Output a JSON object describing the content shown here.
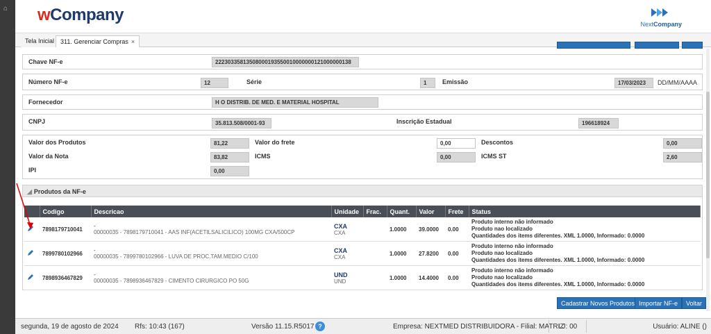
{
  "header": {
    "logo_w": "w",
    "logo_company": "Company",
    "next_logo_prefix": "Next",
    "next_logo_suffix": "Company"
  },
  "tabs": [
    {
      "label": "Tela Inicial"
    },
    {
      "label": "311. Gerenciar Compras",
      "close": "×"
    }
  ],
  "form": {
    "chave_label": "Chave NF-e",
    "chave_value": "22230335813508000193550010000000121000000138",
    "numero_label": "Número NF-e",
    "numero_value": "12",
    "serie_label": "Série",
    "serie_value": "1",
    "emissao_label": "Emissão",
    "emissao_value": "17/03/2023",
    "emissao_format": "DD/MM/AAAA",
    "fornecedor_label": "Fornecedor",
    "fornecedor_value": "H O DISTRIB. DE MED. E MATERIAL HOSPITAL",
    "cnpj_label": "CNPJ",
    "cnpj_value": "35.813.508/0001-93",
    "ie_label": "Inscrição Estadual",
    "ie_value": "196618924",
    "valor_produtos_label": "Valor dos Produtos",
    "valor_produtos_value": "81,22",
    "valor_frete_label": "Valor do frete",
    "valor_frete_value": "0,00",
    "descontos_label": "Descontos",
    "descontos_value": "0,00",
    "valor_nota_label": "Valor da Nota",
    "valor_nota_value": "83,82",
    "icms_label": "ICMS",
    "icms_value": "0,00",
    "icms_st_label": "ICMS ST",
    "icms_st_value": "2,60",
    "ipi_label": "IPI",
    "ipi_value": "0,00"
  },
  "produtos": {
    "section_title": "Produtos da NF-e",
    "columns": [
      "Codigo",
      "Descricao",
      "Unidade",
      "Frac.",
      "Quant.",
      "Valor",
      "Frete",
      "Status"
    ],
    "rows": [
      {
        "codigo": "7898179710041",
        "dash": "-",
        "descricao": "00000035 - 7898179710041 - AAS INF(ACETILSALICILICO) 100MG CXA/500CP",
        "unidade1": "CXA",
        "unidade2": "CXA",
        "frac": "",
        "quant": "1.0000",
        "valor": "39.0000",
        "frete": "0.00",
        "status1": "Produto interno não informado",
        "status2": "Produto nao localizado",
        "status3": "Quantidades dos items diferentes. XML 1.0000, Informado: 0.0000"
      },
      {
        "codigo": "7899780102966",
        "dash": "-",
        "descricao": "00000035 - 7899780102966 - LUVA DE PROC.TAM.MEDIO C/100",
        "unidade1": "CXA",
        "unidade2": "CXA",
        "frac": "",
        "quant": "1.0000",
        "valor": "27.8200",
        "frete": "0.00",
        "status1": "Produto interno não informado",
        "status2": "Produto nao localizado",
        "status3": "Quantidades dos items diferentes. XML 1.0000, Informado: 0.0000"
      },
      {
        "codigo": "7898936467829",
        "dash": "-",
        "descricao": "00000035 - 7898936467829 - CIMENTO CIRURGICO PO 50G",
        "unidade1": "UND",
        "unidade2": "UND",
        "frac": "",
        "quant": "1.0000",
        "valor": "14.4000",
        "frete": "0.00",
        "status1": "Produto interno não informado",
        "status2": "Produto nao localizado",
        "status3": "Quantidades dos items diferentes. XML 1.0000, Informado: 0.0000"
      }
    ]
  },
  "buttons": {
    "cadastrar": "Cadastrar Novos Produtos",
    "importar": "Importar NF-e",
    "voltar": "Voltar"
  },
  "footer": {
    "date": "segunda, 19 de agosto de 2024",
    "rfs": "Rfs: 10:43 (167)",
    "version": "Versão 11.15.R5017",
    "help": "?",
    "empresa": "Empresa: NEXTMED DISTRIBUIDORA - Filial: MATRIZ",
    "lj": "LJ: 00",
    "usuario": "Usuário: ALINE ()"
  },
  "colors": {
    "accent": "#2a72b5",
    "grid_header": "#4a4f57",
    "status_error": "#e00000",
    "brand_red": "#d92b1e",
    "brand_navy": "#1f3a6b"
  },
  "icons": [
    "home-icon",
    "close-icon",
    "pencil-icon",
    "help-icon",
    "collapse-triangle-icon"
  ]
}
